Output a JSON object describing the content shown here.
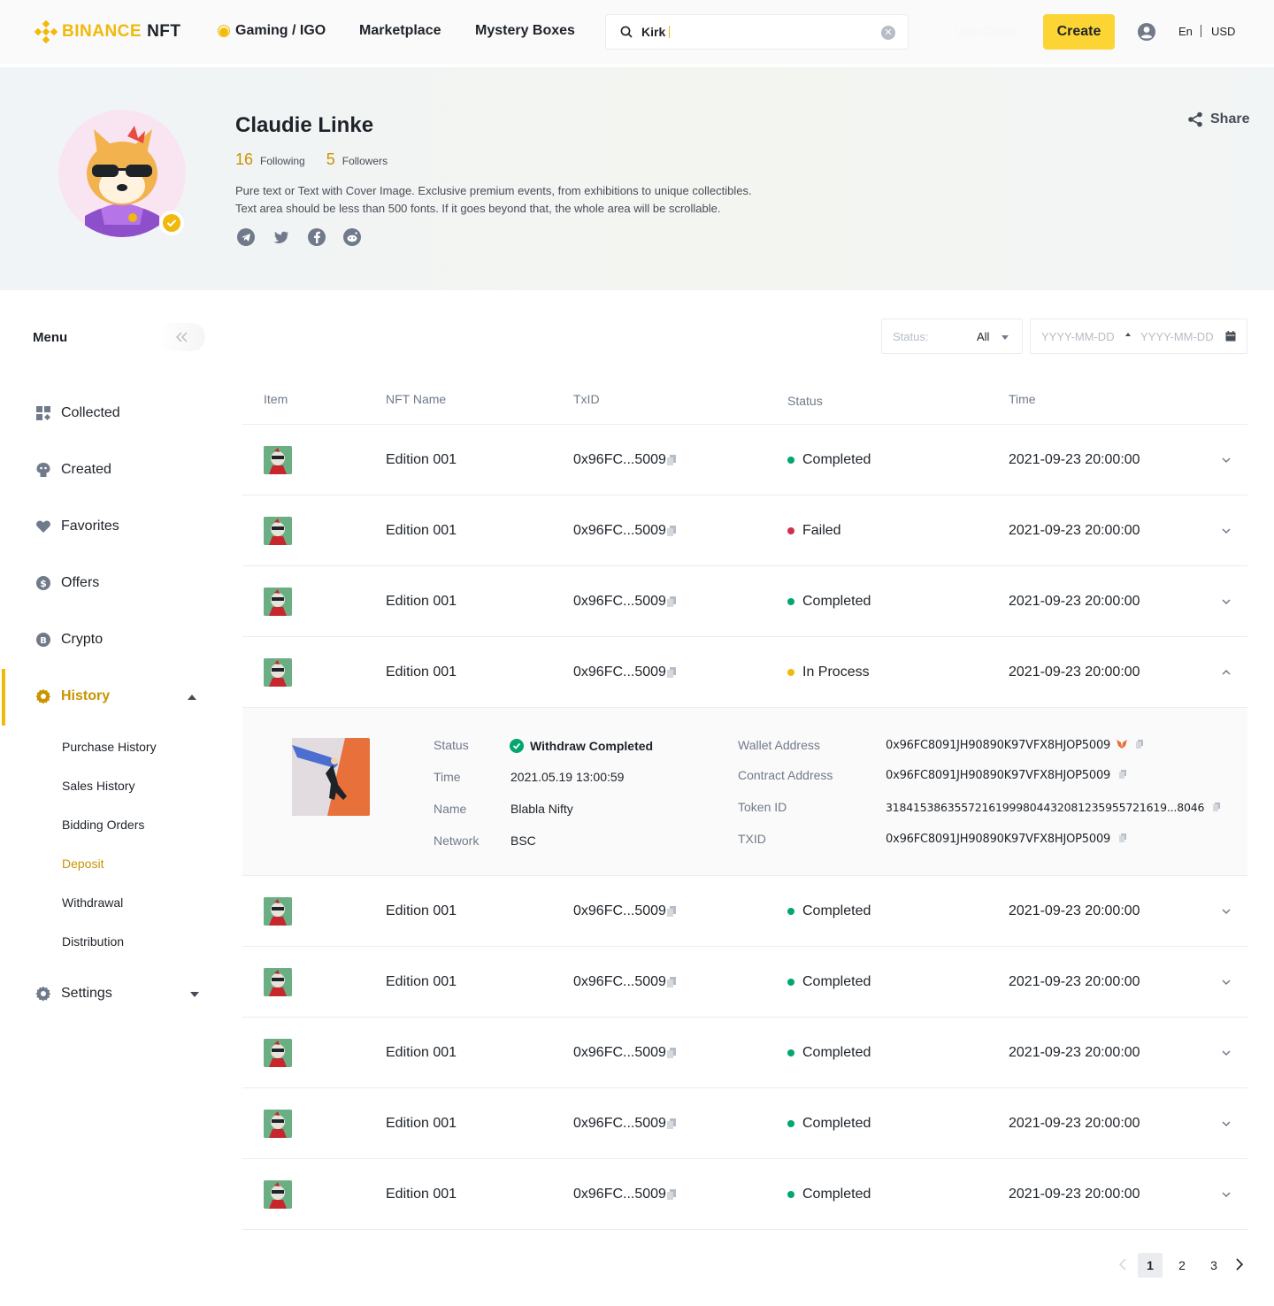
{
  "header": {
    "brand": "BINANCE",
    "brand_suffix": "NFT",
    "nav": {
      "gaming": "Gaming / IGO",
      "marketplace": "Marketplace",
      "mystery": "Mystery Boxes"
    },
    "search": {
      "value": "Kirk"
    },
    "create_label": "Create",
    "language": "En",
    "currency": "USD",
    "faint_link": "User Center"
  },
  "profile": {
    "name": "Claudie Linke",
    "following_count": "16",
    "following_label": "Following",
    "followers_count": "5",
    "followers_label": "Followers",
    "bio_line1": "Pure text or Text with Cover Image. Exclusive premium events, from exhibitions to unique collectibles.",
    "bio_line2": "Text area should be less than 500 fonts. If it goes beyond that, the whole area will be scrollable.",
    "share_label": "Share",
    "socials": [
      "telegram-icon",
      "twitter-icon",
      "facebook-icon",
      "reddit-icon"
    ]
  },
  "sidebar": {
    "title": "Menu",
    "items": [
      {
        "label": "Collected",
        "icon": "grid-icon"
      },
      {
        "label": "Created",
        "icon": "palette-icon"
      },
      {
        "label": "Favorites",
        "icon": "heart-icon"
      },
      {
        "label": "Offers",
        "icon": "dollar-icon"
      },
      {
        "label": "Crypto",
        "icon": "bitcoin-icon"
      },
      {
        "label": "History",
        "icon": "gear-icon"
      },
      {
        "label": "Settings",
        "icon": "gear-icon"
      }
    ],
    "history_sub": [
      "Purchase History",
      "Sales History",
      "Bidding Orders",
      "Deposit",
      "Withdrawal",
      "Distribution"
    ],
    "active_sub": "Deposit"
  },
  "filters": {
    "status_label": "Status:",
    "status_value": "All",
    "date_from_placeholder": "YYYY-MM-DD",
    "date_to_placeholder": "YYYY-MM-DD"
  },
  "table": {
    "headers": {
      "item": "Item",
      "name": "NFT Name",
      "txid": "TxID",
      "status": "Status",
      "time": "Time"
    },
    "rows": [
      {
        "name": "Edition 001",
        "txid": "0x96FC...5009",
        "status": "Completed",
        "time": "2021-09-23 20:00:00"
      },
      {
        "name": "Edition 001",
        "txid": "0x96FC...5009",
        "status": "Failed",
        "time": "2021-09-23 20:00:00"
      },
      {
        "name": "Edition 001",
        "txid": "0x96FC...5009",
        "status": "Completed",
        "time": "2021-09-23 20:00:00"
      },
      {
        "name": "Edition 001",
        "txid": "0x96FC...5009",
        "status": "In Process",
        "time": "2021-09-23 20:00:00"
      },
      {
        "name": "Edition 001",
        "txid": "0x96FC...5009",
        "status": "Completed",
        "time": "2021-09-23 20:00:00"
      },
      {
        "name": "Edition 001",
        "txid": "0x96FC...5009",
        "status": "Completed",
        "time": "2021-09-23 20:00:00"
      },
      {
        "name": "Edition 001",
        "txid": "0x96FC...5009",
        "status": "Completed",
        "time": "2021-09-23 20:00:00"
      },
      {
        "name": "Edition 001",
        "txid": "0x96FC...5009",
        "status": "Completed",
        "time": "2021-09-23 20:00:00"
      },
      {
        "name": "Edition 001",
        "txid": "0x96FC...5009",
        "status": "Completed",
        "time": "2021-09-23 20:00:00"
      }
    ],
    "status_colors": {
      "Completed": "#03A66D",
      "Failed": "#CF304A",
      "In Process": "#F0B90B"
    }
  },
  "detail": {
    "status_label": "Status",
    "status_value": "Withdraw Completed",
    "time_label": "Time",
    "time_value": "2021.05.19 13:00:59",
    "name_label": "Name",
    "name_value": "Blabla Nifty",
    "network_label": "Network",
    "network_value": "BSC",
    "wallet_label": "Wallet Address",
    "wallet_value": "0x96FC8091JH90890K97VFX8HJOP5009",
    "contract_label": "Contract Address",
    "contract_value": "0x96FC8091JH90890K97VFX8HJOP5009",
    "token_label": "Token ID",
    "token_value": "318415386355721619998044320812359557216​19...8046",
    "txid_label": "TXID",
    "txid_value": "0x96FC8091JH90890K97VFX8HJOP5009"
  },
  "pagination": {
    "pages": [
      "1",
      "2",
      "3"
    ],
    "current": "1"
  },
  "colors": {
    "brand": "#F0B90B",
    "accent_text": "#C99400",
    "create_bg": "#FCD535"
  }
}
